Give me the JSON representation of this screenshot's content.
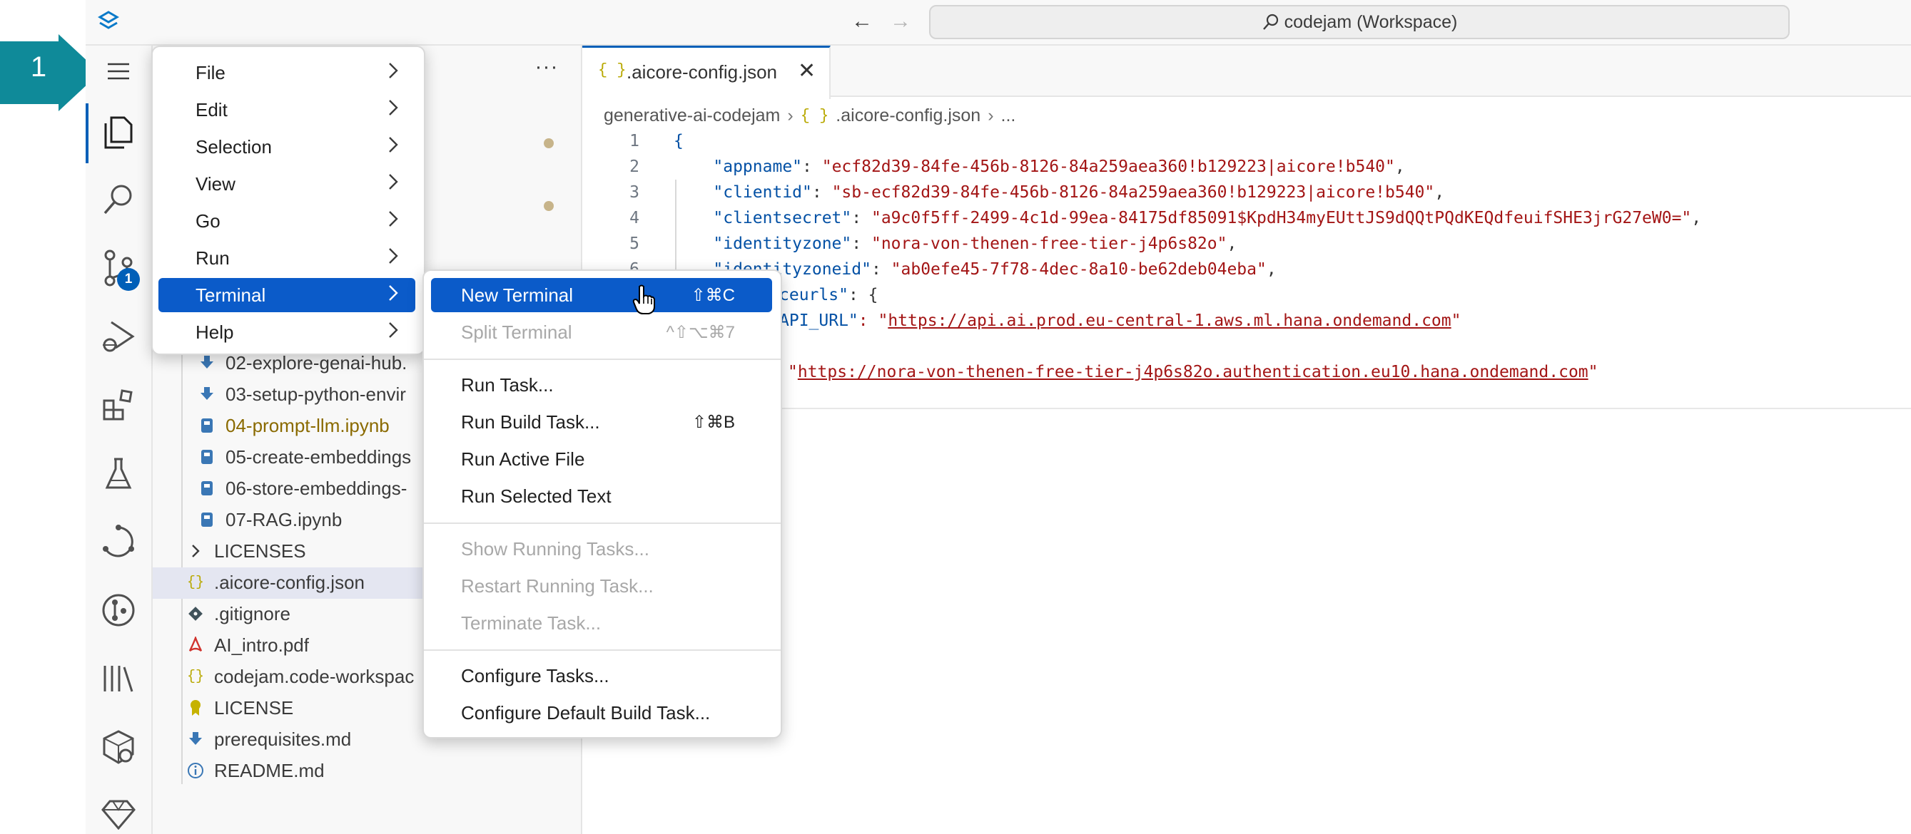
{
  "callout": {
    "number": "1",
    "color": "#0f8a99"
  },
  "titlebar": {
    "command_center": "codejam (Workspace)"
  },
  "activity_bar": {
    "items": [
      "hamburger-menu",
      "explorer",
      "search",
      "source-control",
      "run-and-debug",
      "extensions",
      "testing",
      "api",
      "git-graph",
      "library",
      "cube",
      "gem"
    ],
    "scm_badge": "1"
  },
  "explorer": {
    "rows": [
      {
        "label": "02-explore-genai-hub.",
        "icon": "download-icon",
        "color": "#3b3b3b"
      },
      {
        "label": "03-setup-python-envir",
        "icon": "download-icon",
        "color": "#3b3b3b"
      },
      {
        "label": "04-prompt-llm.ipynb",
        "icon": "notebook-icon",
        "color": "#8a6a00"
      },
      {
        "label": "05-create-embeddings",
        "icon": "notebook-icon",
        "color": "#3b3b3b"
      },
      {
        "label": "06-store-embeddings-",
        "icon": "notebook-icon",
        "color": "#3b3b3b"
      },
      {
        "label": "07-RAG.ipynb",
        "icon": "notebook-icon",
        "color": "#3b3b3b"
      },
      {
        "label": "LICENSES",
        "icon": "chevron-right-icon",
        "color": "#3b3b3b"
      },
      {
        "label": ".aicore-config.json",
        "icon": "json-icon",
        "color": "#3b3b3b"
      },
      {
        "label": ".gitignore",
        "icon": "git-icon",
        "color": "#3b3b3b"
      },
      {
        "label": "AI_intro.pdf",
        "icon": "pdf-icon",
        "color": "#3b3b3b"
      },
      {
        "label": "codejam.code-workspac",
        "icon": "json-icon",
        "color": "#3b3b3b"
      },
      {
        "label": "LICENSE",
        "icon": "license-icon",
        "color": "#3b3b3b"
      },
      {
        "label": "prerequisites.md",
        "icon": "download-icon",
        "color": "#3b3b3b"
      },
      {
        "label": "README.md",
        "icon": "info-icon",
        "color": "#3b3b3b"
      }
    ]
  },
  "editor": {
    "tab": {
      "icon": "{ }",
      "label": ".aicore-config.json"
    },
    "breadcrumb": {
      "folder": "generative-ai-codejam",
      "icon": "{ }",
      "file": ".aicore-config.json",
      "more": "..."
    },
    "lines": [
      {
        "n": "1",
        "text": "{"
      },
      {
        "n": "2",
        "key": "\"appname\"",
        "value": "\"ecf82d39-84fe-456b-8126-84a259aea360!b129223|aicore!b540\"",
        "tail": ","
      },
      {
        "n": "3",
        "key": "\"clientid\"",
        "value": "\"sb-ecf82d39-84fe-456b-8126-84a259aea360!b129223|aicore!b540\"",
        "tail": ","
      },
      {
        "n": "4",
        "key": "\"clientsecret\"",
        "value": "\"a9c0f5ff-2499-4c1d-99ea-84175df85091$KpdH34myEUttJS9dQQtPQdKEQdfeuifSHE3jrG27eW0=\"",
        "tail": ","
      },
      {
        "n": "5",
        "key": "\"identityzone\"",
        "value": "\"nora-von-thenen-free-tier-j4p6s82o\"",
        "tail": ","
      },
      {
        "n": "6",
        "key": "\"identityzoneid\"",
        "value": "\"ab0efe45-7f78-4dec-8a10-be62deb04eba\"",
        "tail": ","
      },
      {
        "frag_key": "ceurls\"",
        "frag_tail": ": {"
      },
      {
        "frag_key": "API_URL\"",
        "frag_mid": ": \"",
        "frag_url": "https://api.ai.prod.eu-central-1.aws.ml.hana.ondemand.com",
        "frag_end": "\""
      },
      {
        "frag_mid": "\"",
        "frag_url": "https://nora-von-thenen-free-tier-j4p6s82o.authentication.eu10.hana.ondemand.com",
        "frag_end": "\""
      }
    ]
  },
  "main_menu": {
    "items": [
      {
        "label": "File"
      },
      {
        "label": "Edit"
      },
      {
        "label": "Selection"
      },
      {
        "label": "View"
      },
      {
        "label": "Go"
      },
      {
        "label": "Run"
      },
      {
        "label": "Terminal",
        "selected": true
      },
      {
        "label": "Help"
      }
    ]
  },
  "terminal_menu": {
    "groups": [
      [
        {
          "label": "New Terminal",
          "shortcut": "⇧⌘C",
          "selected": true
        },
        {
          "label": "Split Terminal",
          "shortcut": "^⇧⌥⌘7",
          "disabled": true
        }
      ],
      [
        {
          "label": "Run Task..."
        },
        {
          "label": "Run Build Task...",
          "shortcut": "⇧⌘B"
        },
        {
          "label": "Run Active File"
        },
        {
          "label": "Run Selected Text"
        }
      ],
      [
        {
          "label": "Show Running Tasks...",
          "disabled": true
        },
        {
          "label": "Restart Running Task...",
          "disabled": true
        },
        {
          "label": "Terminate Task...",
          "disabled": true
        }
      ],
      [
        {
          "label": "Configure Tasks..."
        },
        {
          "label": "Configure Default Build Task..."
        }
      ]
    ]
  }
}
